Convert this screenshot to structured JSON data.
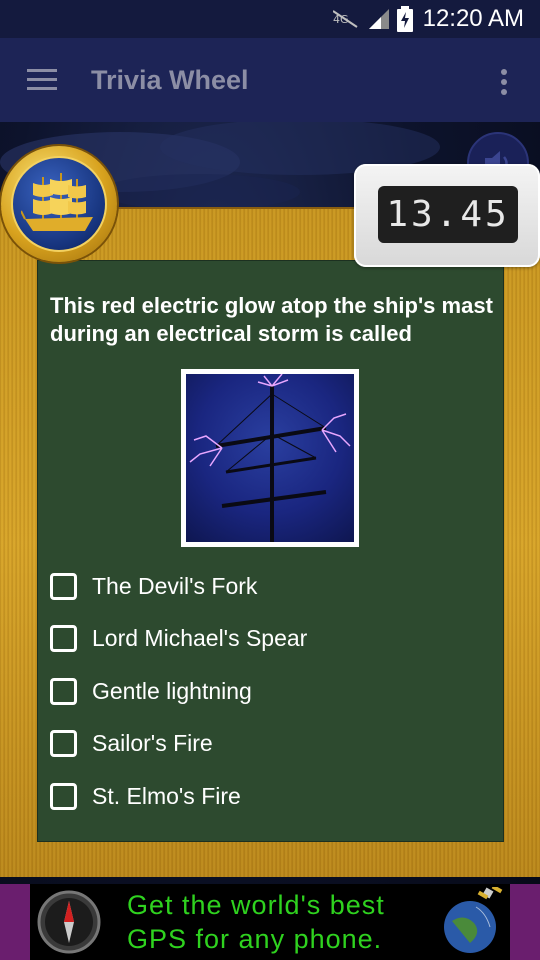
{
  "status_bar": {
    "time": "12:20 AM",
    "icons": [
      "network-off-icon",
      "signal-icon",
      "battery-charging-icon"
    ]
  },
  "app_bar": {
    "title": "Trivia Wheel",
    "menu_icon": "hamburger-menu-icon",
    "overflow_icon": "more-vert-icon"
  },
  "timer": {
    "value": "13.45"
  },
  "question": {
    "text": "This red electric glow atop the ship's mast during an electrical storm is called",
    "image": "ship-mast-lightning"
  },
  "options": [
    {
      "label": "The Devil's Fork",
      "checked": false
    },
    {
      "label": "Lord Michael's Spear",
      "checked": false
    },
    {
      "label": "Gentle lightning",
      "checked": false
    },
    {
      "label": "Sailor's Fire",
      "checked": false
    },
    {
      "label": "St. Elmo's Fire",
      "checked": false
    }
  ],
  "ad": {
    "line1": "Get the world's best",
    "line2": "GPS for any phone."
  },
  "colors": {
    "app_bar": "#1d2456",
    "board": "#2d4a2f",
    "frame": "#d9a52a",
    "ad_text": "#2fd21f"
  }
}
